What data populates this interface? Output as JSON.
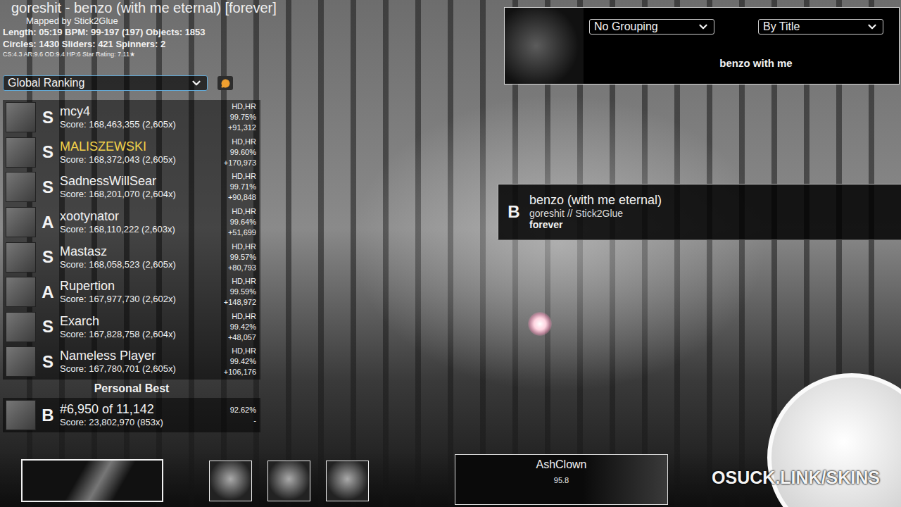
{
  "beatmap": {
    "title": "goreshit - benzo (with me eternal) [forever]",
    "mapper": "Mapped by Stick2Glue",
    "stats": "Length: 05:19 BPM: 99-197 (197) Objects: 1853",
    "counts": "Circles: 1430 Sliders: 421 Spinners: 2",
    "difficulty": "CS:4.3 AR:9.6 OD:9.4 HP:6 Star Rating: 7.11★"
  },
  "ranking_dropdown": {
    "label": "Global Ranking"
  },
  "scores": [
    {
      "rank": "S",
      "name": "mcy4",
      "score": "Score: 168,463,355 (2,605x)",
      "mods": "HD,HR",
      "accuracy": "99.75%",
      "diff": "+91,312",
      "friend": false
    },
    {
      "rank": "S",
      "name": "MALISZEWSKI",
      "score": "Score: 168,372,043 (2,605x)",
      "mods": "HD,HR",
      "accuracy": "99.60%",
      "diff": "+170,973",
      "friend": true
    },
    {
      "rank": "S",
      "name": "SadnessWillSear",
      "score": "Score: 168,201,070 (2,604x)",
      "mods": "HD,HR",
      "accuracy": "99.71%",
      "diff": "+90,848",
      "friend": false
    },
    {
      "rank": "A",
      "name": "xootynator",
      "score": "Score: 168,110,222 (2,603x)",
      "mods": "HD,HR",
      "accuracy": "99.64%",
      "diff": "+51,699",
      "friend": false
    },
    {
      "rank": "S",
      "name": "Mastasz",
      "score": "Score: 168,058,523 (2,605x)",
      "mods": "HD,HR",
      "accuracy": "99.57%",
      "diff": "+80,793",
      "friend": false
    },
    {
      "rank": "A",
      "name": "Rupertion",
      "score": "Score: 167,977,730 (2,602x)",
      "mods": "HD,HR",
      "accuracy": "99.59%",
      "diff": "+148,972",
      "friend": false
    },
    {
      "rank": "S",
      "name": "Exarch",
      "score": "Score: 167,828,758 (2,604x)",
      "mods": "HD,HR",
      "accuracy": "99.42%",
      "diff": "+48,057",
      "friend": false
    },
    {
      "rank": "S",
      "name": "Nameless Player",
      "score": "Score: 167,780,701 (2,605x)",
      "mods": "HD,HR",
      "accuracy": "99.42%",
      "diff": "+106,176",
      "friend": false
    }
  ],
  "personal_best": {
    "heading": "Personal Best",
    "rank": "B",
    "position": "#6,950 of 11,142",
    "score": "Score: 23,802,970 (853x)",
    "accuracy": "92.62%",
    "diff": "-"
  },
  "filters": {
    "grouping": "No Grouping",
    "sort": "By Title",
    "search": "benzo with me"
  },
  "song_card": {
    "rank": "B",
    "title": "benzo (with me eternal)",
    "artist": "goreshit // Stick2Glue",
    "difficulty": "forever",
    "selected": true
  },
  "user": {
    "name": "AshClown",
    "value": "95.8"
  },
  "watermark": "OSUCK.LINK/SKINS"
}
